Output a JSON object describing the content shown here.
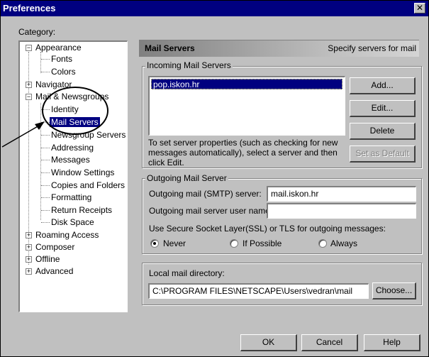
{
  "window": {
    "title": "Preferences"
  },
  "category_label": "Category:",
  "tree": {
    "appearance": "Appearance",
    "fonts": "Fonts",
    "colors": "Colors",
    "navigator": "Navigator",
    "mail_newsgroups": "Mail & Newsgroups",
    "identity": "Identity",
    "mail_servers": "Mail Servers",
    "newsgroup_servers": "Newsgroup Servers",
    "addressing": "Addressing",
    "messages": "Messages",
    "window_settings": "Window Settings",
    "copies_folders": "Copies and Folders",
    "formatting": "Formatting",
    "return_receipts": "Return Receipts",
    "disk_space": "Disk Space",
    "roaming_access": "Roaming Access",
    "composer": "Composer",
    "offline": "Offline",
    "advanced": "Advanced"
  },
  "panel": {
    "title": "Mail Servers",
    "subtitle": "Specify servers for mail"
  },
  "incoming": {
    "label": "Incoming Mail Servers",
    "servers": [
      "pop.iskon.hr"
    ],
    "help_text": "To set server properties (such as checking for new messages automatically), select a server and then click Edit.",
    "add_label": "Add...",
    "edit_label": "Edit...",
    "delete_label": "Delete",
    "set_default_label": "Set as Default"
  },
  "outgoing": {
    "label": "Outgoing Mail Server",
    "smtp_label": "Outgoing mail (SMTP) server:",
    "smtp_value": "mail.iskon.hr",
    "user_label": "Outgoing mail server user name:",
    "user_value": "",
    "ssl_label": "Use Secure Socket Layer(SSL) or TLS for outgoing messages:",
    "radio_never": "Never",
    "radio_possible": "If Possible",
    "radio_always": "Always",
    "selected": "never"
  },
  "local": {
    "label": "Local mail directory:",
    "path": "C:\\PROGRAM FILES\\NETSCAPE\\Users\\vedran\\mail",
    "choose_label": "Choose..."
  },
  "footer": {
    "ok_label": "OK",
    "cancel_label": "Cancel",
    "help_label": "Help"
  }
}
